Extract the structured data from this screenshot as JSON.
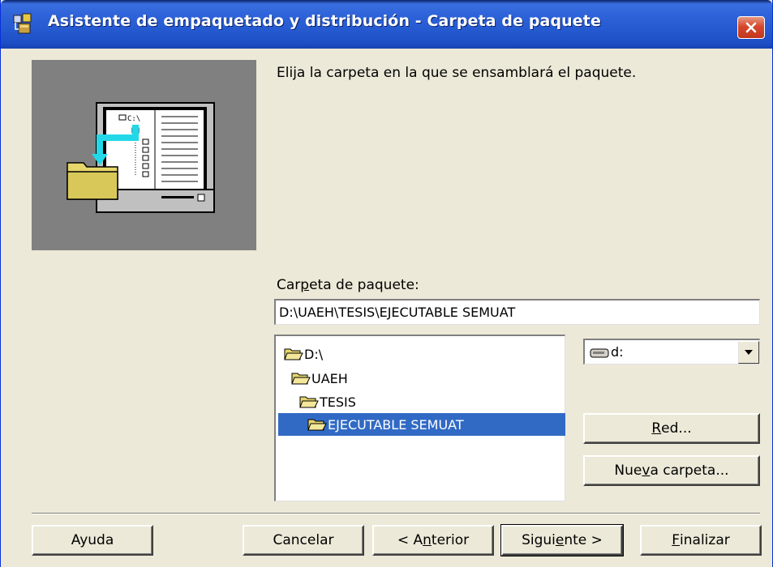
{
  "window": {
    "title": "Asistente de empaquetado y distribución - Carpeta de paquete"
  },
  "instruction": "Elija la carpeta en la que se ensamblará el paquete.",
  "package_folder": {
    "label": "Carpeta de paquete:",
    "value": "D:\\UAEH\\TESIS\\EJECUTABLE SEMUAT"
  },
  "directory_tree": [
    {
      "label": "D:\\",
      "state": "open"
    },
    {
      "label": "UAEH",
      "state": "open"
    },
    {
      "label": "TESIS",
      "state": "open"
    },
    {
      "label": "EJECUTABLE SEMUAT",
      "state": "open-selected"
    }
  ],
  "drive": {
    "selected": "d:",
    "icon": "drive-icon"
  },
  "buttons": {
    "network": "Red...",
    "new_folder": "Nueva carpeta...",
    "help": "Ayuda",
    "cancel": "Cancelar",
    "back": "< Anterior",
    "next": "Siguiente >",
    "finish": "Finalizar"
  },
  "icons": {
    "title": "package-wizard-icon",
    "close": "close-icon",
    "folder": "folder-open-icon",
    "dropdown": "chevron-down-icon"
  },
  "colors": {
    "titlebar": "#255ad1",
    "selection": "#316ac5",
    "dialog": "#ece9d8",
    "close": "#d6472c",
    "illustration_bg": "#808080"
  }
}
